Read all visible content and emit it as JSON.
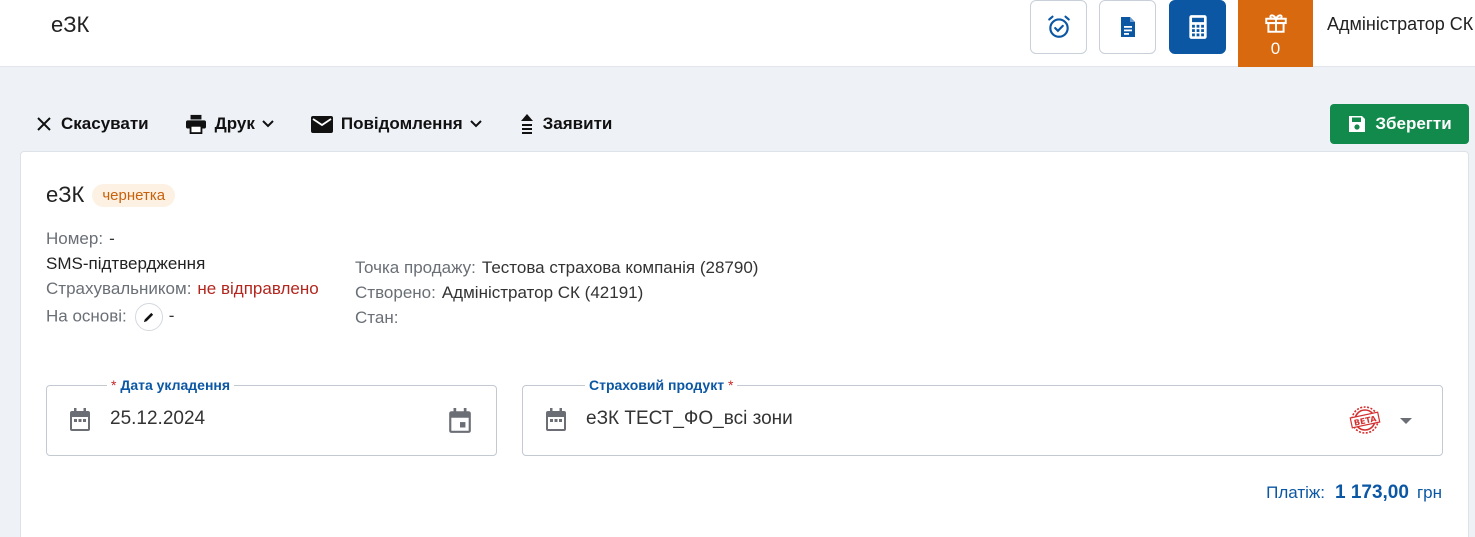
{
  "header": {
    "app_title": "еЗК",
    "gift_count": "0",
    "user_name": "Адміністратор СК"
  },
  "toolbar": {
    "cancel_label": "Скасувати",
    "print_label": "Друк",
    "messages_label": "Повідомлення",
    "submit_label": "Заявити",
    "save_label": "Зберегти"
  },
  "document": {
    "title": "еЗК",
    "status_badge": "чернетка",
    "number_label": "Номер:",
    "number_value": "-",
    "sms_label": "SMS-підтвердження",
    "insurer_label": "Страхувальником:",
    "insurer_value": "не відправлено",
    "basis_label": "На основі:",
    "basis_value": "-",
    "sale_point_label": "Точка продажу:",
    "sale_point_value": "Тестова страхова компанія (28790)",
    "created_label": "Створено:",
    "created_value": "Адміністратор СК (42191)",
    "state_label": "Стан:"
  },
  "form": {
    "date_label": "Дата укладення",
    "date_value": "25.12.2024",
    "product_label": "Страховий продукт",
    "product_value": "еЗК ТЕСТ_ФО_всі зони",
    "required_mark": "*",
    "beta_badge": "BETA"
  },
  "payment": {
    "label": "Платіж:",
    "amount": "1 173,00",
    "currency": "грн"
  },
  "colors": {
    "accent": "#0b57a4",
    "save_green": "#128a4c",
    "gift_orange": "#d9690f",
    "draft_orange": "#c8620a",
    "error_red": "#b3261e"
  },
  "icons": [
    "alarm-clock-icon",
    "document-icon",
    "calculator-icon",
    "gift-icon",
    "close-icon",
    "printer-icon",
    "envelope-icon",
    "upload-icon",
    "save-icon",
    "pencil-icon",
    "calendar-icon",
    "chevron-down-icon"
  ]
}
